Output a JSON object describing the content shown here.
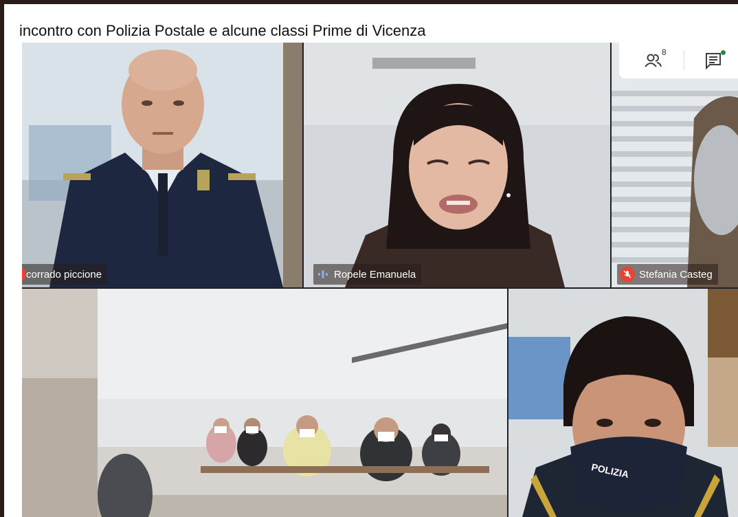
{
  "meeting": {
    "title": "incontro con Polizia Postale e alcune classi Prime di Vicenza"
  },
  "participants_button": {
    "icon": "people-icon",
    "count": "8"
  },
  "chat_button": {
    "icon": "chat-icon"
  },
  "tiles": [
    {
      "name": "corrado piccione",
      "mic_icon": "mic-off-icon"
    },
    {
      "name": "Ropele Emanuela",
      "audio_icon": "speaking-indicator-icon"
    },
    {
      "name": "Stefania Casteg",
      "mic_icon": "mic-off-icon"
    },
    {
      "name": ""
    },
    {
      "name": ""
    }
  ],
  "colors": {
    "mic_off": "#ea4335",
    "speaking": "#8ab4f8",
    "chat_badge": "#1e8e3e"
  }
}
